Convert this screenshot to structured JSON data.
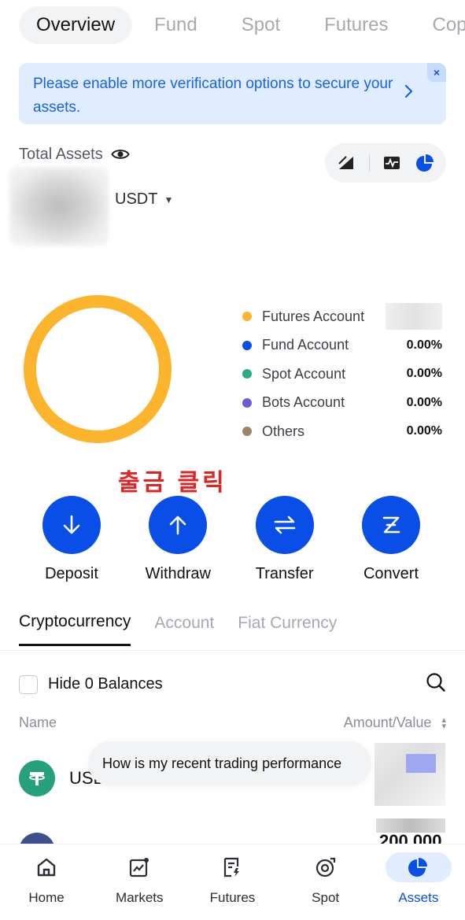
{
  "top_tabs": [
    {
      "label": "Overview",
      "active": true
    },
    {
      "label": "Fund",
      "active": false
    },
    {
      "label": "Spot",
      "active": false
    },
    {
      "label": "Futures",
      "active": false
    },
    {
      "label": "Cop",
      "active": false
    }
  ],
  "banner": {
    "text": "Please enable more verification options to secure your assets.",
    "chevron_icon": "chevron-right-icon",
    "close_icon": "close-icon"
  },
  "total_assets": {
    "label": "Total Assets",
    "currency": "USDT"
  },
  "allocation": {
    "ring_color": "#fbb42c",
    "legend": [
      {
        "name": "Futures Account",
        "value": "",
        "color": "#fbb42c"
      },
      {
        "name": "Fund Account",
        "value": "0.00%",
        "color": "#0a4ee8"
      },
      {
        "name": "Spot Account",
        "value": "0.00%",
        "color": "#2bab7b"
      },
      {
        "name": "Bots Account",
        "value": "0.00%",
        "color": "#6b5cd1"
      },
      {
        "name": "Others",
        "value": "0.00%",
        "color": "#9c8466"
      }
    ]
  },
  "annotation": "출금 클릭",
  "actions": [
    {
      "label": "Deposit",
      "icon": "arrow-down-icon"
    },
    {
      "label": "Withdraw",
      "icon": "arrow-up-icon"
    },
    {
      "label": "Transfer",
      "icon": "swap-icon"
    },
    {
      "label": "Convert",
      "icon": "convert-icon"
    }
  ],
  "sub_tabs": [
    {
      "label": "Cryptocurrency",
      "active": true
    },
    {
      "label": "Account",
      "active": false
    },
    {
      "label": "Fiat Currency",
      "active": false
    }
  ],
  "hide_zero": {
    "label": "Hide 0 Balances"
  },
  "list_header": {
    "name": "Name",
    "amount": "Amount/Value"
  },
  "coins": [
    {
      "name": "USD"
    },
    {
      "name": "",
      "amount": "200,000"
    }
  ],
  "ai_prompt": "How is my recent trading performance",
  "bottom_nav": [
    {
      "label": "Home",
      "icon": "home-icon",
      "active": false
    },
    {
      "label": "Markets",
      "icon": "markets-icon",
      "active": false
    },
    {
      "label": "Futures",
      "icon": "futures-icon",
      "active": false
    },
    {
      "label": "Spot",
      "icon": "spot-icon",
      "active": false
    },
    {
      "label": "Assets",
      "icon": "assets-pie-icon",
      "active": true
    }
  ]
}
